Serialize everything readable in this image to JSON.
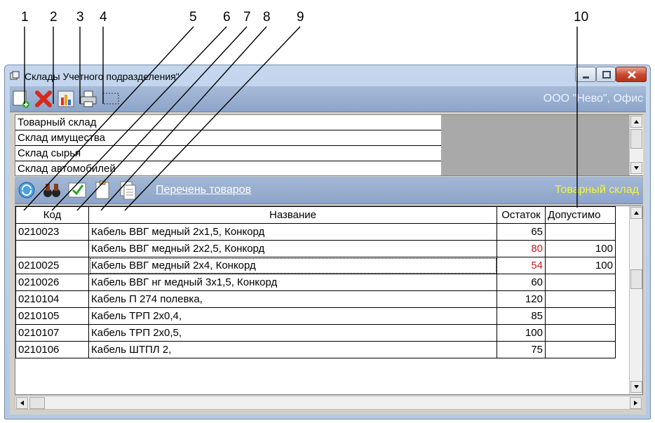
{
  "callouts": [
    "1",
    "2",
    "3",
    "4",
    "5",
    "6",
    "7",
    "8",
    "9",
    "10"
  ],
  "window": {
    "title": "Склады Учетного подразделения\"",
    "org_name": "ООО \"Нево\", Офис"
  },
  "toolbar1": {
    "icons": [
      "add-warehouse-icon",
      "delete-icon",
      "chart-icon",
      "print-icon",
      "filter-icon"
    ]
  },
  "warehouses": [
    "Товарный склад",
    "Склад имущества",
    "Склад сырья",
    "Склад автомобилей"
  ],
  "toolbar2": {
    "icons": [
      "refresh-icon",
      "binoculars-icon",
      "checkmark-doc-icon",
      "clipboard-icon",
      "copy-doc-icon"
    ],
    "list_link": "Перечень товаров",
    "current_warehouse": "Товарный склад"
  },
  "grid": {
    "columns": [
      "Код",
      "Название",
      "Остаток",
      "Допустимо"
    ],
    "rows": [
      {
        "code": "0210023",
        "name": "Кабель ВВГ медный 2х1,5, Конкорд",
        "stock": "65",
        "allowed": "",
        "low": false
      },
      {
        "code": "",
        "name": "Кабель ВВГ медный 2х2,5, Конкорд",
        "stock": "80",
        "allowed": "100",
        "low": true
      },
      {
        "code": "0210025",
        "name": "Кабель ВВГ медный 2х4, Конкорд",
        "stock": "54",
        "allowed": "100",
        "low": true
      },
      {
        "code": "0210026",
        "name": "Кабель ВВГ нг медный 3х1,5, Конкорд",
        "stock": "60",
        "allowed": "",
        "low": false
      },
      {
        "code": "0210104",
        "name": "Кабель П 274 полевка,",
        "stock": "120",
        "allowed": "",
        "low": false
      },
      {
        "code": "0210105",
        "name": "Кабель ТРП 2х0,4,",
        "stock": "85",
        "allowed": "",
        "low": false
      },
      {
        "code": "0210107",
        "name": "Кабель ТРП 2х0,5,",
        "stock": "100",
        "allowed": "",
        "low": false
      },
      {
        "code": "0210106",
        "name": "Кабель ШТПЛ 2,",
        "stock": "75",
        "allowed": "",
        "low": false
      }
    ],
    "selected_row": 2
  },
  "colors": {
    "toolbar_blue": "#8ca4c9",
    "link_white": "#ffffff",
    "current_warehouse_yellow": "#f4f43a",
    "low_stock_red": "#d01818",
    "panel_gray": "#a9a9a9"
  }
}
